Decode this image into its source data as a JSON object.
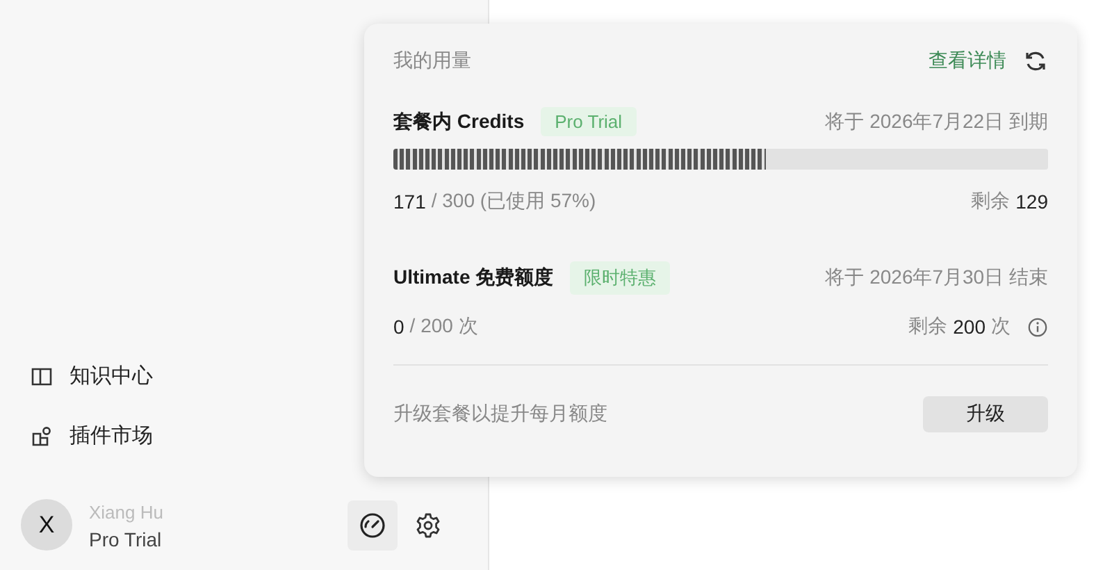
{
  "sidebar": {
    "items": [
      {
        "kind": "book",
        "label": "知识中心"
      },
      {
        "kind": "plugin",
        "label": "插件市场"
      }
    ]
  },
  "user": {
    "initial": "X",
    "name": "Xiang Hu",
    "plan": "Pro Trial"
  },
  "usage_popup": {
    "title": "我的用量",
    "details_link": "查看详情",
    "sections": [
      {
        "kind": "bar",
        "title": "套餐内 Credits",
        "tag": "Pro Trial",
        "date": "将于 2026年7月22日 到期",
        "level": 0.57,
        "used": "171",
        "total": "/ 300 (已使用 57%)",
        "remaining_label": "剩余",
        "remaining": "129"
      },
      {
        "kind": "count",
        "title": "Ultimate 免费额度",
        "tag": "限时特惠",
        "date": "将于 2026年7月30日 结束",
        "used": "0",
        "total": "/ 200 次",
        "remaining_label": "剩余",
        "remaining": "200",
        "remaining_unit": "次"
      }
    ],
    "footer_text": "升级套餐以提升每月额度",
    "upgrade_button": "升级"
  }
}
